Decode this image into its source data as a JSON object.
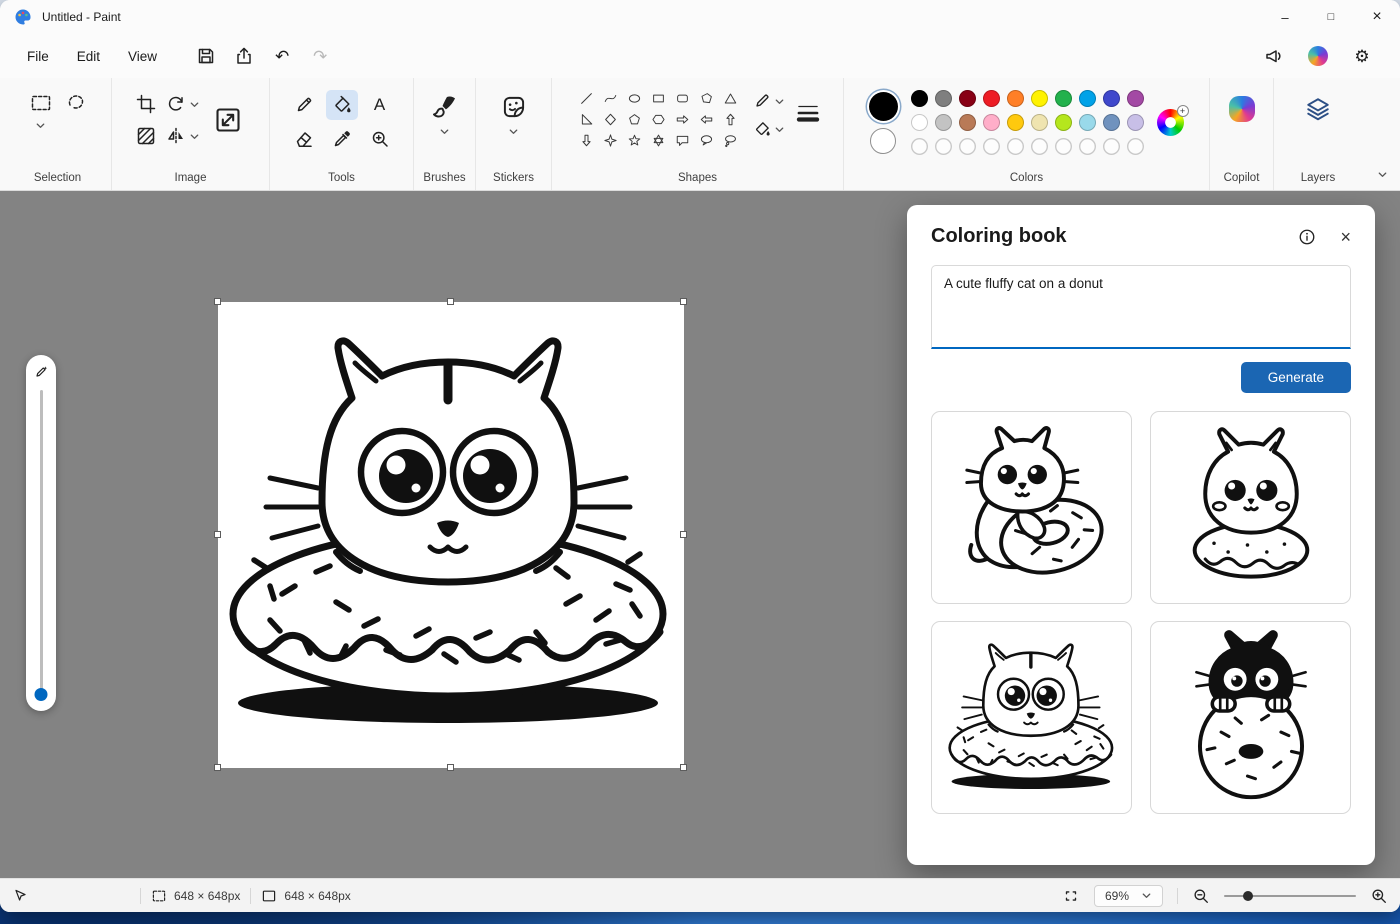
{
  "window": {
    "title": "Untitled - Paint",
    "controls": {
      "minimize": "–",
      "maximize": "□",
      "close": "×"
    }
  },
  "menubar": {
    "items": [
      "File",
      "Edit",
      "View"
    ]
  },
  "icons": {
    "undo": "↶",
    "redo": "↷",
    "gear": "⚙",
    "plus": "+",
    "text_tool": "A"
  },
  "ribbon": {
    "groups": {
      "selection": "Selection",
      "image": "Image",
      "tools": "Tools",
      "brushes": "Brushes",
      "stickers": "Stickers",
      "shapes": "Shapes",
      "colors": "Colors",
      "copilot": "Copilot",
      "layers": "Layers"
    },
    "selected_tool": "fill",
    "shapes_list": [
      "line",
      "curve",
      "oval",
      "rectangle",
      "rounded-rectangle",
      "polygon",
      "triangle",
      "right-triangle",
      "diamond",
      "pentagon",
      "hexagon",
      "arrow-right",
      "arrow-left",
      "arrow-up",
      "arrow-down",
      "four-point-star",
      "five-point-star",
      "six-point-star",
      "speech-bubble",
      "oval-callout",
      "thought-bubble"
    ]
  },
  "colors": {
    "foreground": "#000000",
    "background": "#ffffff",
    "palette": [
      [
        "#000000",
        "#7f7f7f",
        "#880015",
        "#ed1c24",
        "#ff7f27",
        "#fff200",
        "#22b14c",
        "#00a2e8",
        "#3f48cc",
        "#a349a4"
      ],
      [
        "#ffffff",
        "#c3c3c3",
        "#b97a57",
        "#ffaec9",
        "#ffc90e",
        "#efe4b0",
        "#b5e61d",
        "#99d9ea",
        "#7092be",
        "#c8bfe7"
      ]
    ],
    "empty_slots": 10
  },
  "coloring_book": {
    "title": "Coloring book",
    "prompt": "A cute fluffy cat on a donut",
    "generate_label": "Generate",
    "thumbnails": [
      {
        "name": "cat-hugging-donut"
      },
      {
        "name": "fluffy-cat-on-donut"
      },
      {
        "name": "cat-in-donut"
      },
      {
        "name": "black-cat-behind-donut"
      }
    ]
  },
  "canvas": {
    "artwork": "cat-in-donut-line-art"
  },
  "statusbar": {
    "selection_size": "648 × 648px",
    "canvas_size": "648 × 648px",
    "zoom": "69%"
  },
  "theme": {
    "accent": "#0067c0",
    "generate_button": "#1b66b3",
    "canvas_surround": "#838383",
    "selected_tool_bg": "#d5e4f6"
  }
}
